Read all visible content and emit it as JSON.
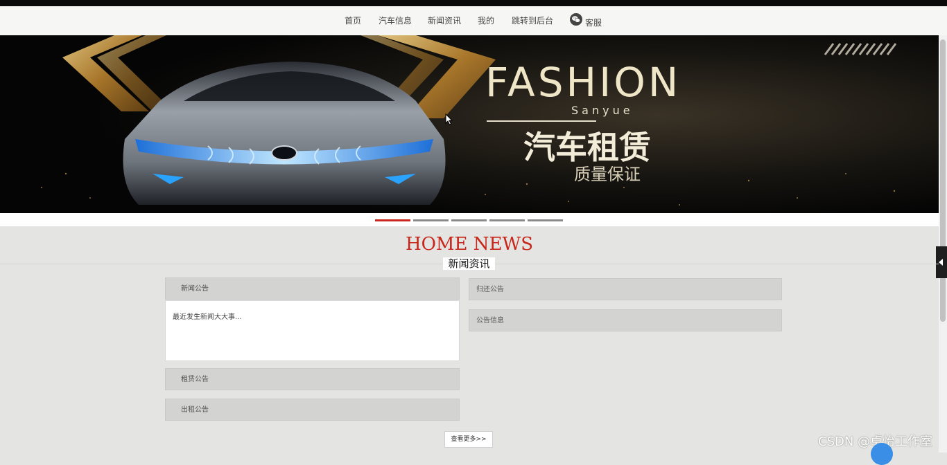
{
  "nav": {
    "items": [
      "首页",
      "汽车信息",
      "新闻资讯",
      "我的",
      "跳转到后台"
    ],
    "service_label": "客服",
    "service_icon": "wechat-icon"
  },
  "banner": {
    "headline": "FASHION",
    "subline": "Sanyue",
    "title": "汽车租赁",
    "tagline": "质量保证",
    "slide_count": 5,
    "active_slide": 1
  },
  "news_section": {
    "title": "HOME NEWS",
    "subtitle": "新闻资讯"
  },
  "panels": {
    "left": [
      {
        "label": "新闻公告",
        "body": "最近发生新闻大大事..."
      },
      {
        "label": "租赁公告"
      },
      {
        "label": "出租公告"
      }
    ],
    "right": [
      {
        "label": "归还公告"
      },
      {
        "label": "公告信息"
      }
    ]
  },
  "more_button": "查看更多>>",
  "watermark": "CSDN @卓怡工作室",
  "colors": {
    "accent": "#c8261a",
    "banner_bg": "#0b0b0b",
    "gold": "#e9dcb8"
  }
}
